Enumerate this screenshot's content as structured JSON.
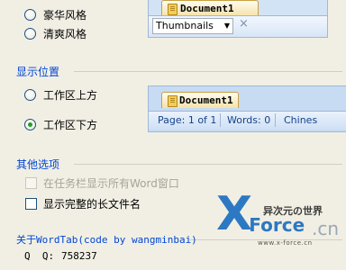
{
  "style_options": {
    "option1": "豪华风格",
    "option2": "清爽风格"
  },
  "style_preview": {
    "doc_tab": "Document1",
    "dropdown_value": "Thumbnails",
    "close_glyph": "×"
  },
  "position_group": {
    "title": "显示位置",
    "option_top": "工作区上方",
    "option_bottom": "工作区下方",
    "selected": "option_bottom"
  },
  "position_preview": {
    "doc_tab": "Document1",
    "page": "Page: 1 of 1",
    "words": "Words: 0",
    "lang": "Chines"
  },
  "other_group": {
    "title": "其他选项",
    "check1": "在任务栏显示所有Word窗口",
    "check2": "显示完整的长文件名"
  },
  "about_group": {
    "title": "关于WordTab(code by wangminbai)",
    "qq_label": "Q  Q:",
    "qq_value": "758237"
  },
  "watermark": {
    "brand_x": "X",
    "brand_force": "-Force",
    "brand_cn": ".cn",
    "site_text": "异次元の世界",
    "url": "www.x-force.cn"
  },
  "colors": {
    "group_title": "#0046d5",
    "radio_dot": "#21a121",
    "preview_bg": "#c6dcf4",
    "watermark_blue": "#2d78c2"
  }
}
